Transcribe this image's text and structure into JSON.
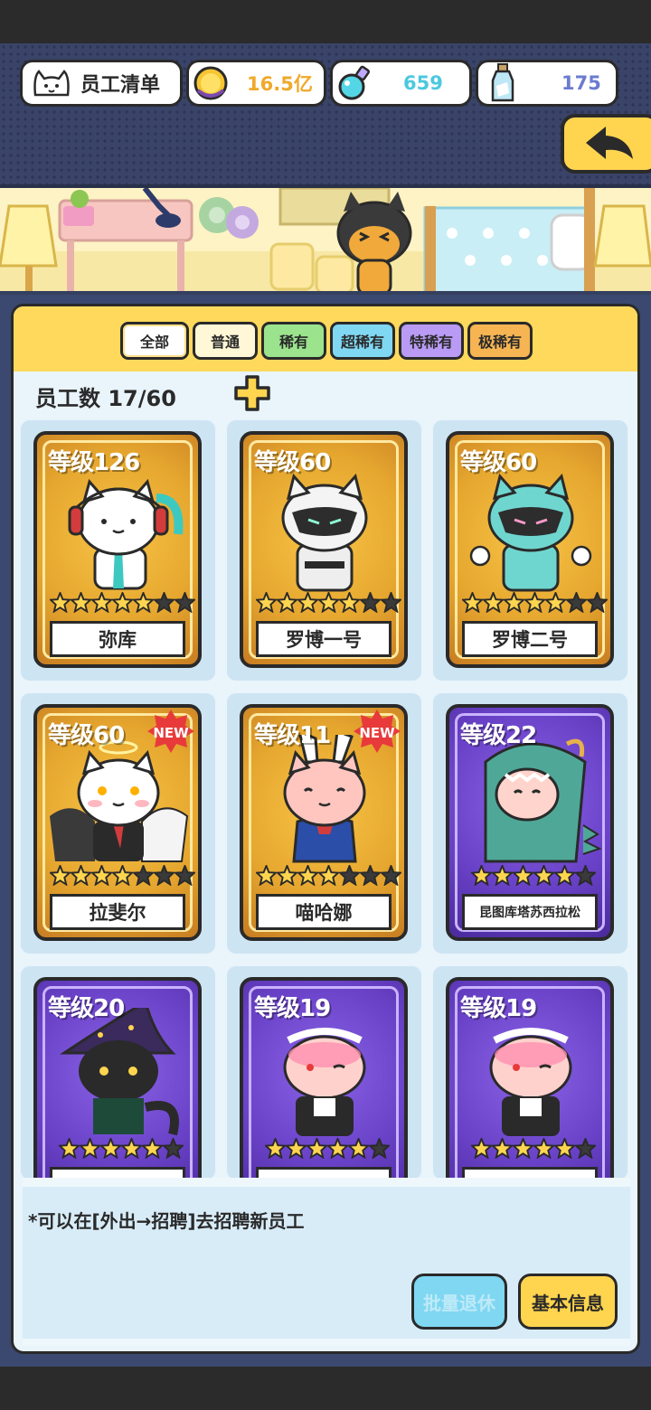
{
  "header": {
    "title": "员工清单",
    "coins": "16.5亿",
    "potions": "659",
    "bottles": "175"
  },
  "filters": [
    {
      "label": "全部",
      "color": "#ffffff"
    },
    {
      "label": "普通",
      "color": "#fff7d6"
    },
    {
      "label": "稀有",
      "color": "#9be38d"
    },
    {
      "label": "超稀有",
      "color": "#7fd7f2"
    },
    {
      "label": "特稀有",
      "color": "#b99af5"
    },
    {
      "label": "极稀有",
      "color": "#f6b552"
    }
  ],
  "employee_count": "员工数 17/60",
  "employees": [
    {
      "level": "等级126",
      "name": "弥库",
      "rarity": "gold",
      "stars": 5,
      "new": false
    },
    {
      "level": "等级60",
      "name": "罗博一号",
      "rarity": "gold",
      "stars": 5,
      "new": false
    },
    {
      "level": "等级60",
      "name": "罗博二号",
      "rarity": "gold",
      "stars": 5,
      "new": false
    },
    {
      "level": "等级60",
      "name": "拉斐尔",
      "rarity": "gold",
      "stars": 5,
      "new": true
    },
    {
      "level": "等级11",
      "name": "喵哈娜",
      "rarity": "gold",
      "stars": 5,
      "new": true
    },
    {
      "level": "等级22",
      "name": "昆图库塔苏西拉松",
      "rarity": "purple",
      "stars": 5,
      "new": false
    },
    {
      "level": "等级20",
      "name": "",
      "rarity": "purple",
      "stars": 5,
      "new": false
    },
    {
      "level": "等级19",
      "name": "",
      "rarity": "purple",
      "stars": 5,
      "new": false
    },
    {
      "level": "等级19",
      "name": "",
      "rarity": "purple",
      "stars": 5,
      "new": false
    }
  ],
  "new_label": "NEW",
  "hint": "*可以在[外出→招聘]去招聘新员工",
  "buttons": {
    "retire": "批量退休",
    "info": "基本信息"
  }
}
